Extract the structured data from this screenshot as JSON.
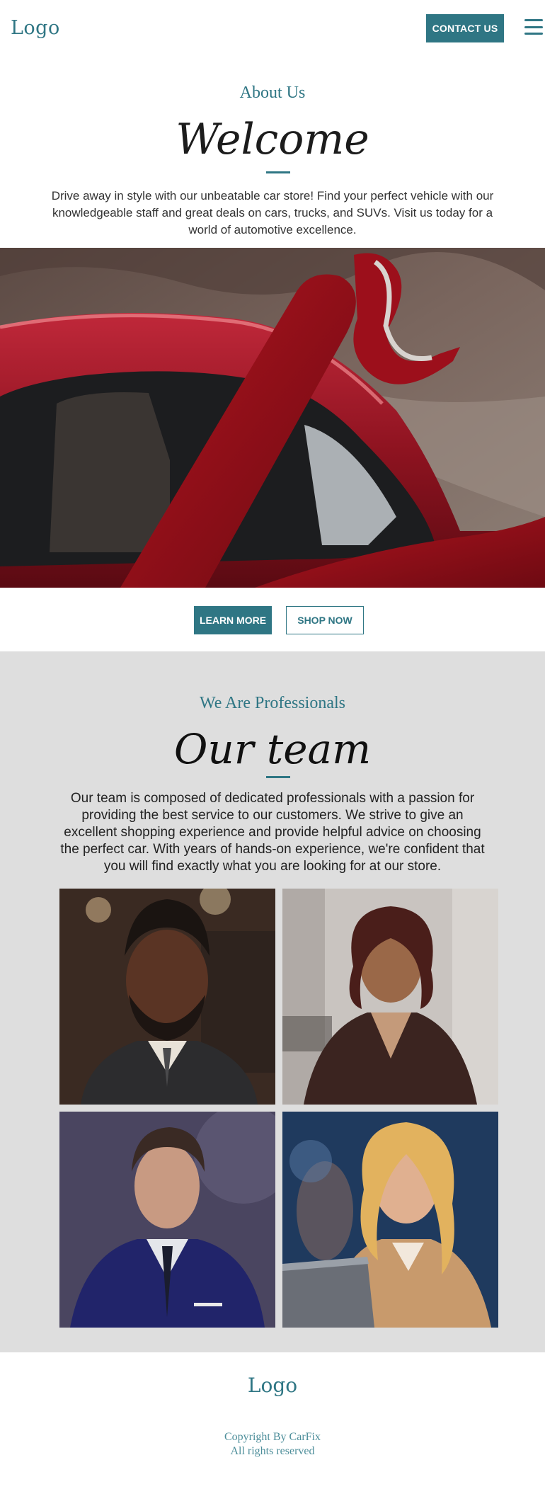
{
  "header": {
    "logo": "Logo",
    "contact_label": "CONTACT US",
    "menu_icon": "hamburger-menu-icon"
  },
  "welcome": {
    "eyebrow": "About Us",
    "title": "Welcome",
    "text": "Drive away in style with our unbeatable car store! Find your perfect vehicle with our knowledgeable staff and great deals on cars, trucks, and SUVs. Visit us today for a world of automotive excellence."
  },
  "hero": {
    "image": "red-car-with-red-high-heels-photo"
  },
  "cta": {
    "learn_more": "LEARN MORE",
    "shop_now": "SHOP NOW"
  },
  "team": {
    "eyebrow": "We Are Professionals",
    "title": "Our team",
    "text": "Our team is composed of dedicated professionals with a passion for providing the best service to our customers. We strive to give an excellent shopping experience and provide helpful advice on choosing the perfect car. With years of hands-on experience, we're confident that you will find exactly what you are looking for at our store.",
    "members": [
      {
        "image": "bearded-man-portrait"
      },
      {
        "image": "woman-business-suit-portrait"
      },
      {
        "image": "man-blue-suit-portrait"
      },
      {
        "image": "blonde-woman-laptop-portrait"
      }
    ]
  },
  "footer": {
    "logo": "Logo",
    "copyright_line1": "Copyright By CarFix",
    "copyright_line2": "All rights reserved"
  },
  "colors": {
    "accent": "#2f7684",
    "team_bg": "#dedede"
  }
}
